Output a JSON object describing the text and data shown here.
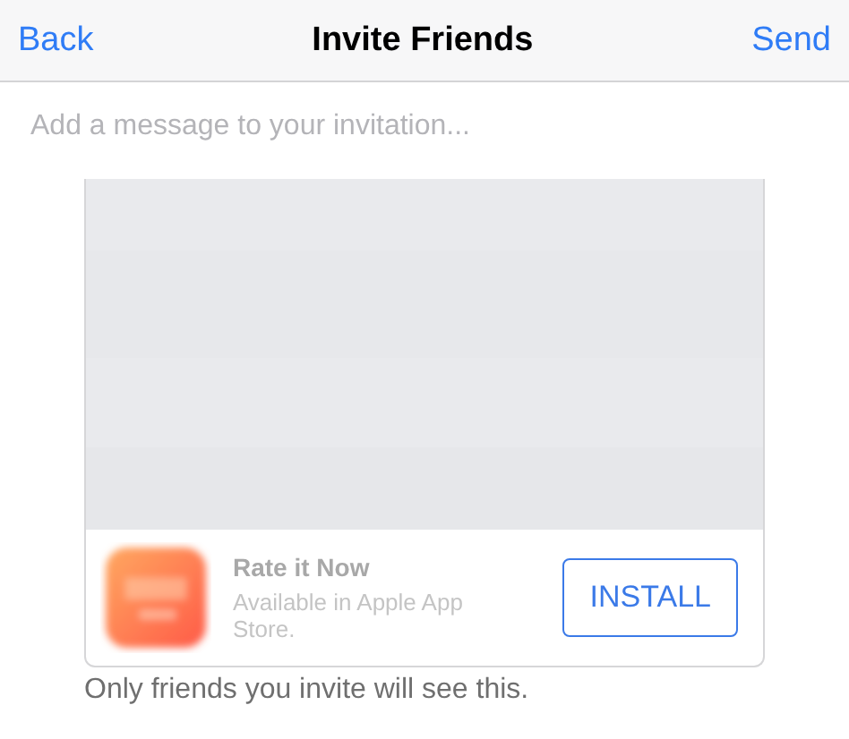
{
  "nav_bar": {
    "back": "Back",
    "title": "Invite Friends",
    "send": "Send"
  },
  "message": {
    "placeholder": "Add a message to your invitation..."
  },
  "app_card": {
    "app_name": "Rate it Now",
    "subtitle": "Available in Apple App Store.",
    "install": "INSTALL"
  },
  "footer": "Only friends you invite will see this."
}
